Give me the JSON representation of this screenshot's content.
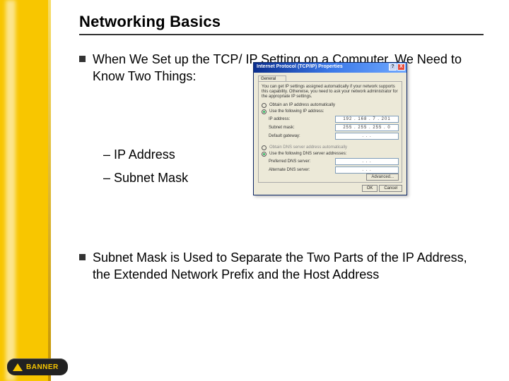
{
  "slide": {
    "title": "Networking Basics",
    "bullets": [
      "When We Set up the TCP/ IP Setting on a Computer, We Need to Know Two Things:",
      "Subnet Mask is Used to Separate the Two Parts of the IP Address, the Extended Network Prefix and the Host Address"
    ],
    "subbullets": [
      "IP Address",
      "Subnet Mask"
    ]
  },
  "dialog": {
    "title": "Internet Protocol (TCP/IP) Properties",
    "help_btn": "?",
    "close_btn": "X",
    "tab": "General",
    "intro": "You can get IP settings assigned automatically if your network supports this capability. Otherwise, you need to ask your network administrator for the appropriate IP settings.",
    "radio_auto": "Obtain an IP address automatically",
    "radio_manual": "Use the following IP address:",
    "fields": {
      "ip_label": "IP address:",
      "ip_value": "192 . 168 .  7  . 201",
      "mask_label": "Subnet mask:",
      "mask_value": "255 . 255 . 255 .  0",
      "gw_label": "Default gateway:",
      "gw_value": " .  .  . "
    },
    "radio_dns_auto": "Obtain DNS server address automatically",
    "radio_dns_manual": "Use the following DNS server addresses:",
    "dns1_label": "Preferred DNS server:",
    "dns2_label": "Alternate DNS server:",
    "dns_empty": " .  .  . ",
    "advanced_btn": "Advanced...",
    "ok_btn": "OK",
    "cancel_btn": "Cancel"
  },
  "logo": {
    "text": "BANNER"
  }
}
